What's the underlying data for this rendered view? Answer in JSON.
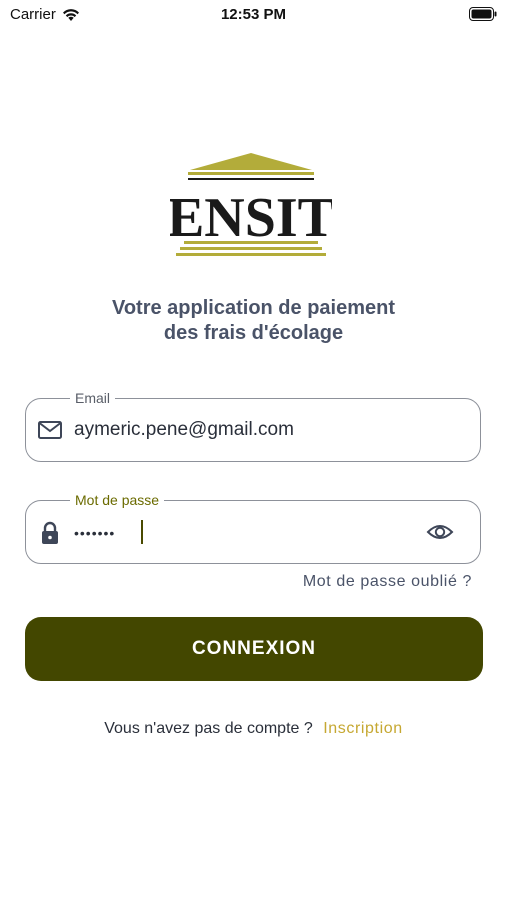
{
  "status_bar": {
    "carrier": "Carrier",
    "time": "12:53 PM"
  },
  "logo": {
    "text": "ENSIT",
    "colors": {
      "gold": "#b3ac3a",
      "dark": "#1a1a1a"
    }
  },
  "tagline": {
    "line1": "Votre application de paiement",
    "line2": "des frais d'écolage"
  },
  "email_field": {
    "label": "Email",
    "value": "aymeric.pene@gmail.com",
    "icon": "mail-icon"
  },
  "password_field": {
    "label": "Mot de passe",
    "value": "•••••••",
    "icon": "lock-icon",
    "toggle_icon": "eye-icon"
  },
  "forgot_password": "Mot de passe oublié ?",
  "login_button": "CONNEXION",
  "signup": {
    "prompt": "Vous n'avez pas de compte ?",
    "link": "Inscription"
  },
  "colors": {
    "accent": "#434700",
    "link": "#c6a832",
    "label_focus": "#6b6b00",
    "text": "#2a2f3a"
  }
}
